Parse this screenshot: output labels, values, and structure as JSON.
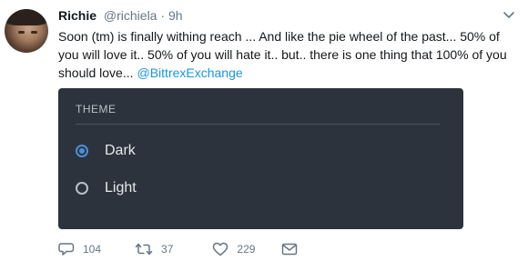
{
  "tweet": {
    "author_name": "Richie",
    "handle": "@richiela",
    "separator": "·",
    "time": "9h",
    "text": "Soon (tm) is finally withing reach ... And like the pie wheel of the past... 50% of you will love it.. 50% of you will hate it.. but.. there is one thing that 100% of you should love...",
    "mention": "@BittrexExchange"
  },
  "media": {
    "theme_label": "THEME",
    "options": [
      {
        "label": "Dark",
        "selected": true
      },
      {
        "label": "Light",
        "selected": false
      }
    ],
    "background_color": "#2d333c",
    "accent_color": "#4a90d9"
  },
  "actions": {
    "reply_count": "104",
    "retweet_count": "37",
    "like_count": "229"
  },
  "icons": [
    "chevron-down-icon",
    "reply-icon",
    "retweet-icon",
    "heart-icon",
    "envelope-icon"
  ]
}
